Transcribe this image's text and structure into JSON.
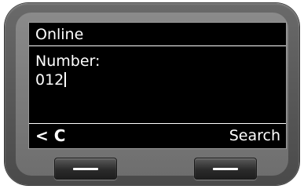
{
  "screen": {
    "status_title": "Online",
    "field_label": "Number:",
    "field_value": "012"
  },
  "softkeys": {
    "left_label": "< C",
    "right_label": "Search"
  },
  "colors": {
    "display_background": "#000000",
    "display_text": "#ffffff",
    "device_body": "#6a6a6a",
    "hardware_key": "#2b2b2b"
  }
}
